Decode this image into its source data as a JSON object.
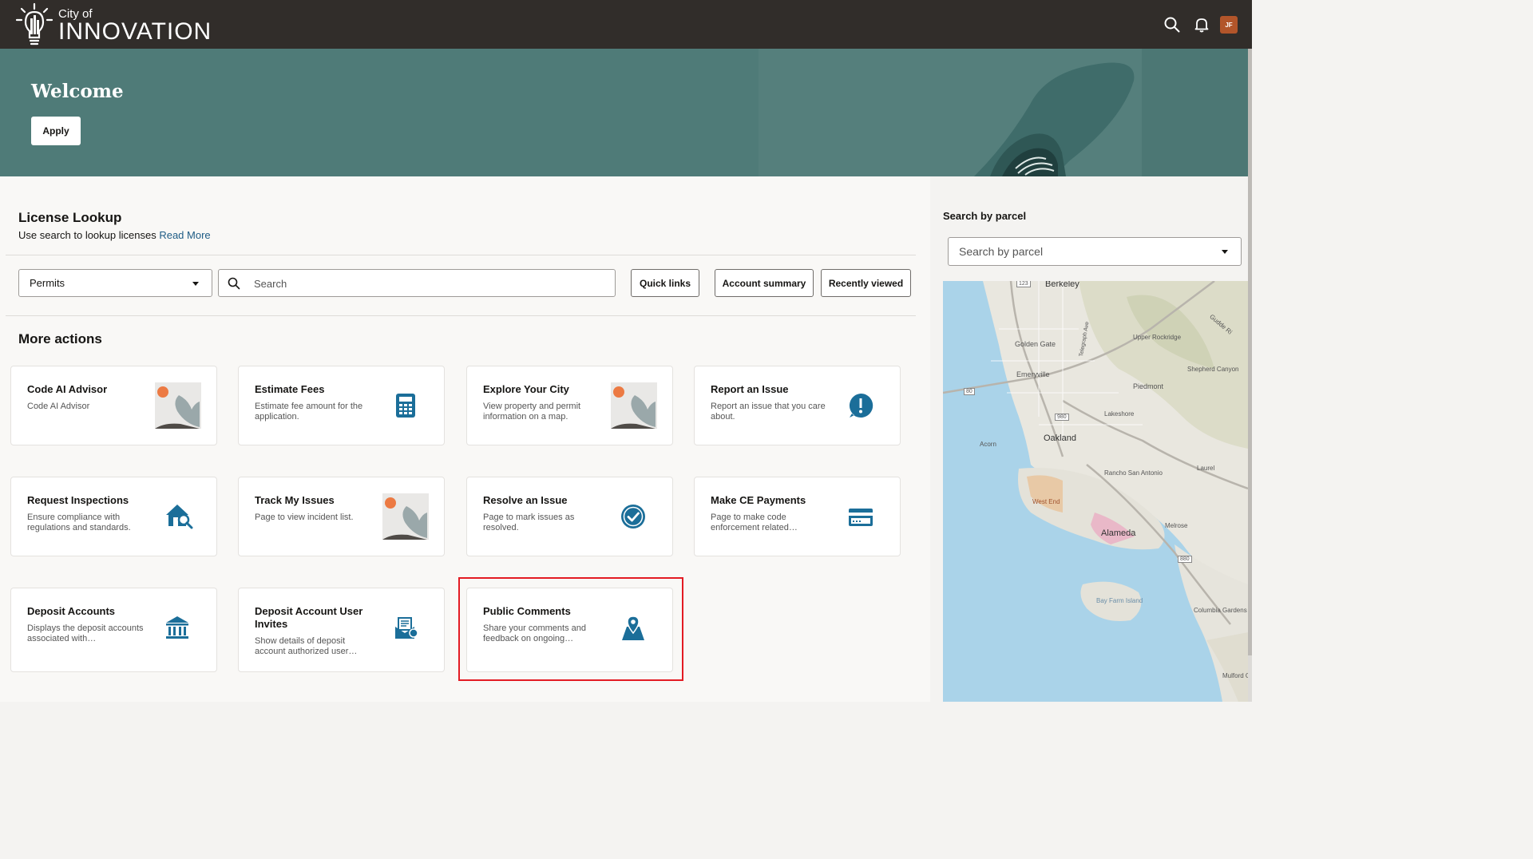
{
  "header": {
    "brand_small": "City of",
    "brand_big": "INNOVATION",
    "user_initials": "JF",
    "icons": [
      "search-icon",
      "bell-icon"
    ]
  },
  "hero": {
    "title": "Welcome",
    "apply_label": "Apply"
  },
  "license_lookup": {
    "title": "License Lookup",
    "subtitle": "Use search to lookup licenses",
    "read_more": "Read More",
    "category_select": "Permits",
    "search_placeholder": "Search",
    "buttons": {
      "quick_links": "Quick links",
      "account_summary": "Account summary",
      "recently_viewed": "Recently viewed"
    }
  },
  "more_actions": {
    "title": "More actions",
    "cards": [
      {
        "title": "Code AI Advisor",
        "desc": "Code AI Advisor",
        "icon": "image-placeholder-icon"
      },
      {
        "title": "Estimate Fees",
        "desc": "Estimate fee amount for the application.",
        "icon": "calculator-icon"
      },
      {
        "title": "Explore Your City",
        "desc": "View property and permit information on a map.",
        "icon": "image-placeholder-icon"
      },
      {
        "title": "Report an Issue",
        "desc": "Report an issue that you care about.",
        "icon": "exclamation-icon"
      },
      {
        "title": "Request Inspections",
        "desc": "Ensure compliance with regulations and standards.",
        "icon": "house-inspect-icon"
      },
      {
        "title": "Track My Issues",
        "desc": "Page to view incident list.",
        "icon": "image-placeholder-icon"
      },
      {
        "title": "Resolve an Issue",
        "desc": "Page to mark issues as resolved.",
        "icon": "check-circle-icon"
      },
      {
        "title": "Make CE Payments",
        "desc": "Page to make code enforcement related…",
        "icon": "credit-card-icon"
      },
      {
        "title": "Deposit Accounts",
        "desc": "Displays the deposit accounts associated with…",
        "icon": "bank-icon"
      },
      {
        "title": "Deposit Account User Invites",
        "desc": "Show details of deposit account authorized user…",
        "icon": "invite-icon"
      },
      {
        "title": "Public Comments",
        "desc": "Share your comments and feedback on ongoing…",
        "icon": "map-pin-icon"
      }
    ]
  },
  "parcel": {
    "title": "Search by parcel",
    "placeholder": "Search by parcel",
    "map_labels": {
      "berkeley": "Berkeley",
      "golden_gate": "Golden Gate",
      "telegraph": "Telegraph Ave",
      "upper_rockridge": "Upper Rockridge",
      "shepherd_canyon": "Shepherd Canyon",
      "emeryville": "Emeryville",
      "piedmont": "Piedmont",
      "lakeshore": "Lakeshore",
      "oakland": "Oakland",
      "acorn": "Acorn",
      "rancho": "Rancho San Antonio",
      "laurel": "Laurel",
      "west_end": "West End",
      "alameda": "Alameda",
      "melrose": "Melrose",
      "bay_farm": "Bay Farm Island",
      "columbia": "Columbia Gardens",
      "mulford": "Mulford Gardens",
      "gudde": "Gudde Ri",
      "hwy123": "123",
      "hwy80": "80",
      "hwy980": "980",
      "hwy880": "880"
    }
  },
  "colors": {
    "topbar": "#312d2a",
    "hero": "#4f7b78",
    "accent": "#1e5c85",
    "icon_blue": "#1b6e99",
    "highlight": "#e31b23"
  }
}
